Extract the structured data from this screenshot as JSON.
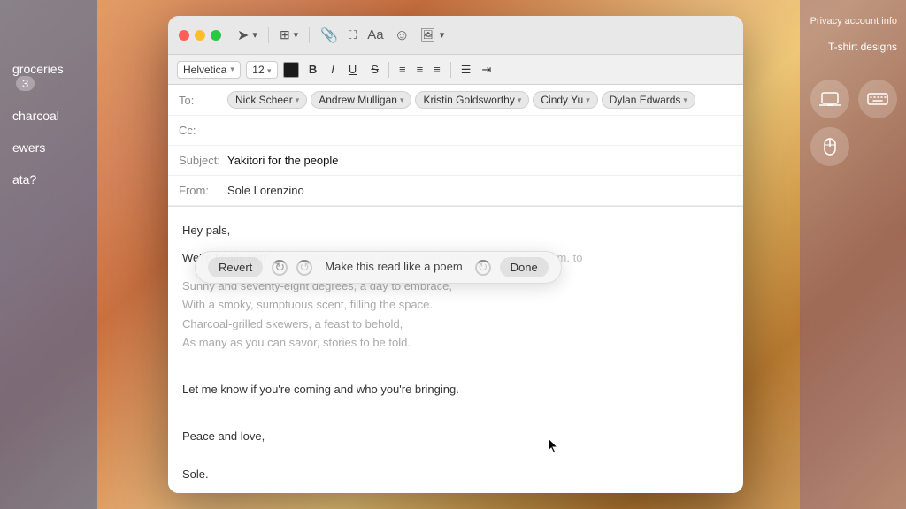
{
  "background": {
    "gradient": "macOS Monterey"
  },
  "sidebar": {
    "items": [
      {
        "label": "groceries",
        "badge": "3"
      },
      {
        "label": "charcoal"
      },
      {
        "label": "ewers"
      },
      {
        "label": "ata?"
      }
    ]
  },
  "right_panel": {
    "title": "Privacy account info",
    "item": "T-shirt designs"
  },
  "mail_window": {
    "toolbar": {
      "send_icon": "➤",
      "dropdown_icon": "▾",
      "archive_icon": "⊡",
      "paper_clip_icon": "🖇",
      "fullscreen_icon": "⛶",
      "font_icon": "Aa",
      "emoji_icon": "☺",
      "photo_icon": "🖼"
    },
    "format_bar": {
      "font": "Helvetica",
      "size": "12",
      "bold_label": "B",
      "italic_label": "I",
      "underline_label": "U",
      "strikethrough_label": "S",
      "align_left": "≡",
      "align_center": "≡",
      "align_right": "≡",
      "list_icon": "≡",
      "indent_icon": "⇥"
    },
    "header": {
      "to_label": "To:",
      "cc_label": "Cc:",
      "subject_label": "Subject:",
      "from_label": "From:",
      "recipients": [
        "Nick Scheer",
        "Andrew Mulligan",
        "Kristin Goldsworthy",
        "Cindy Yu",
        "Dylan Edwards"
      ],
      "subject": "Yakitori for the people",
      "from": "Sole Lorenzino"
    },
    "body": {
      "greeting": "Hey pals,",
      "intro_visible": "We're finally sett",
      "intro_hidden": "ling the details for our yakitori night. Please join us at 7 p.m. to",
      "poem_line1": "Sunny and seventy-eight degrees, a day to embrace,",
      "poem_line2": "With a smoky, sumptuous scent, filling the space.",
      "poem_line3": "Charcoal-grilled skewers, a feast to behold,",
      "poem_line4": "As many as you can savor, stories to be told.",
      "invite": "Let me know if you're coming and who you're bringing.",
      "peace": "Peace and love,",
      "signature": "Sole."
    },
    "ai_toolbar": {
      "revert_label": "Revert",
      "suggestion_label": "Make this read like a poem",
      "done_label": "Done"
    }
  }
}
